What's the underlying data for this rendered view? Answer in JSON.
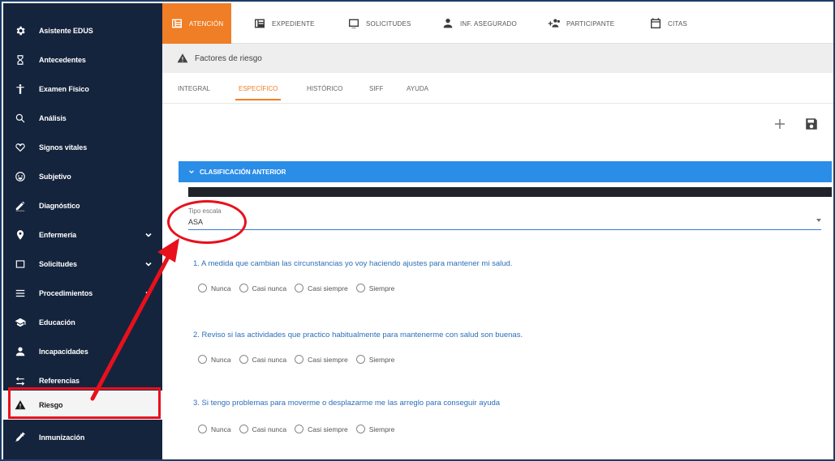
{
  "sidebar": {
    "items": [
      {
        "label": "Asistente EDUS",
        "icon": "gear-icon",
        "chevron": false,
        "active": false
      },
      {
        "label": "Antecedentes",
        "icon": "hourglass-icon",
        "chevron": false,
        "active": false
      },
      {
        "label": "Examen Físico",
        "icon": "person-icon",
        "chevron": false,
        "active": false
      },
      {
        "label": "Análisis",
        "icon": "search-icon",
        "chevron": false,
        "active": false
      },
      {
        "label": "Signos vitales",
        "icon": "heart-icon",
        "chevron": false,
        "active": false
      },
      {
        "label": "Subjetivo",
        "icon": "face-icon",
        "chevron": false,
        "active": false
      },
      {
        "label": "Diagnóstico",
        "icon": "pen-icon",
        "chevron": false,
        "active": false
      },
      {
        "label": "Enfermería",
        "icon": "location-pin-icon",
        "chevron": true,
        "active": false
      },
      {
        "label": "Solicitudes",
        "icon": "window-icon",
        "chevron": true,
        "active": false
      },
      {
        "label": "Procedimientos",
        "icon": "list-icon",
        "chevron": true,
        "active": false
      },
      {
        "label": "Educación",
        "icon": "graduation-cap-icon",
        "chevron": false,
        "active": false
      },
      {
        "label": "Incapacidades",
        "icon": "user-icon",
        "chevron": false,
        "active": false
      },
      {
        "label": "Referencias",
        "icon": "transfer-arrows-icon",
        "chevron": false,
        "active": false
      },
      {
        "label": "Riesgo",
        "icon": "warning-icon",
        "chevron": false,
        "active": true
      },
      {
        "label": "Inmunización",
        "icon": "syringe-icon",
        "chevron": false,
        "active": false
      }
    ]
  },
  "topbar": {
    "tabs": [
      {
        "label": "Atención",
        "icon": "clipboard-icon",
        "active": true
      },
      {
        "label": "Expediente",
        "icon": "folder-icon",
        "active": false
      },
      {
        "label": "Solicitudes",
        "icon": "window-icon",
        "active": false
      },
      {
        "label": "Inf. Asegurado",
        "icon": "user-icon",
        "active": false
      },
      {
        "label": "Participante",
        "icon": "group-add-icon",
        "active": false
      },
      {
        "label": "Citas",
        "icon": "calendar-icon",
        "active": false
      }
    ]
  },
  "section": {
    "title": "Factores de riesgo",
    "icon": "warning-icon"
  },
  "subtabs": [
    {
      "label": "Integral",
      "active": false
    },
    {
      "label": "Específico",
      "active": true
    },
    {
      "label": "Histórico",
      "active": false
    },
    {
      "label": "SIFF",
      "active": false
    },
    {
      "label": "Ayuda",
      "active": false
    }
  ],
  "actions": {
    "add_icon": "plus-icon",
    "save_icon": "save-icon"
  },
  "accordion": {
    "title": "CLASIFICACIÓN ANTERIOR",
    "expanded": true
  },
  "scale_field": {
    "label": "Tipo escala",
    "value": "ASA"
  },
  "questions": [
    {
      "text": "1. A medida que cambian las circunstancias yo voy haciendo ajustes para mantener mi salud.",
      "options": [
        "Nunca",
        "Casi nunca",
        "Casi siempre",
        "Siempre"
      ]
    },
    {
      "text": "2. Reviso si las actividades que practico habitualmente para mantenerme con salud son buenas.",
      "options": [
        "Nunca",
        "Casi nunca",
        "Casi siempre",
        "Siempre"
      ]
    },
    {
      "text": "3. Si tengo problemas para moverme o desplazarme me las arreglo para conseguir ayuda",
      "options": [
        "Nunca",
        "Casi nunca",
        "Casi siempre",
        "Siempre"
      ]
    }
  ],
  "colors": {
    "sidebar_bg": "#14243d",
    "accent_orange": "#f07e26",
    "accordion_blue": "#2a8de8",
    "question_blue": "#2d6fb8",
    "annotation_red": "#e8101c"
  }
}
